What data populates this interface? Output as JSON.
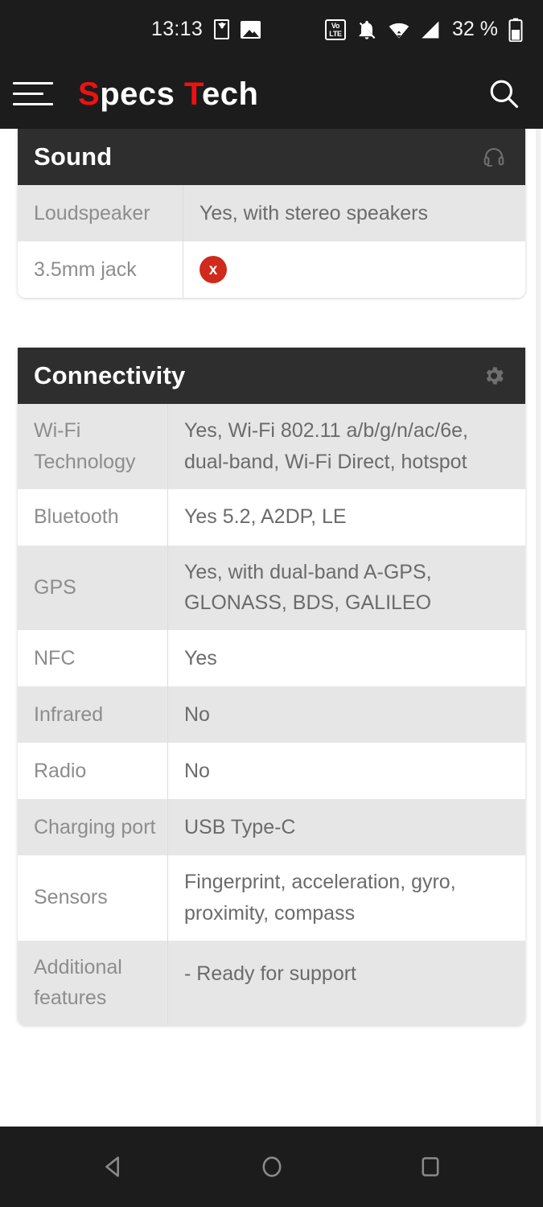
{
  "status_bar": {
    "time": "13:13",
    "battery_text": "32 %",
    "icons": [
      "download-icon",
      "photo-icon",
      "volte-icon",
      "notifications-muted-icon",
      "wifi-icon",
      "cellular-signal-icon",
      "battery-icon"
    ],
    "volte_top": "Vo",
    "volte_bottom": "LTE"
  },
  "app_bar": {
    "logo_part1": "S",
    "logo_part2": "pecs ",
    "logo_part3": "T",
    "logo_part4": "ech",
    "logo_full": "Specs Tech",
    "menu_icon": "hamburger-menu-icon",
    "search_icon": "search-icon",
    "accent_color": "#ee1111"
  },
  "sections": [
    {
      "title": "Sound",
      "icon": "headset-icon",
      "rows": [
        {
          "key": "Loudspeaker",
          "value": "Yes, with stereo speakers",
          "shaded": true,
          "badge": null
        },
        {
          "key": "3.5mm jack",
          "value": "",
          "shaded": false,
          "badge": "x"
        }
      ]
    },
    {
      "title": "Connectivity",
      "icon": "gear-icon",
      "rows": [
        {
          "key": "Wi-Fi Technology",
          "value": "Yes, Wi-Fi 802.11 a/b/g/n/ac/6e, dual-band, Wi-Fi Direct, hotspot",
          "shaded": true,
          "badge": null
        },
        {
          "key": "Bluetooth",
          "value": "Yes 5.2, A2DP, LE",
          "shaded": false,
          "badge": null
        },
        {
          "key": "GPS",
          "value": "Yes, with dual-band A-GPS, GLONASS, BDS, GALILEO",
          "shaded": true,
          "badge": null
        },
        {
          "key": "NFC",
          "value": "Yes",
          "shaded": false,
          "badge": null
        },
        {
          "key": "Infrared",
          "value": "No",
          "shaded": true,
          "badge": null
        },
        {
          "key": "Radio",
          "value": "No",
          "shaded": false,
          "badge": null
        },
        {
          "key": "Charging port",
          "value": "USB Type-C",
          "shaded": true,
          "badge": null
        },
        {
          "key": "Sensors",
          "value": "Fingerprint, acceleration, gyro, proximity, compass",
          "shaded": false,
          "badge": null
        },
        {
          "key": "Additional features",
          "value": "- Ready for support",
          "shaded": true,
          "badge": null
        }
      ]
    }
  ],
  "nav_bar": {
    "back_label": "back-button",
    "home_label": "home-button",
    "recents_label": "recents-button"
  },
  "colors": {
    "status_bar_bg": "#1c1c1c",
    "card_header_bg": "#2e2e2e",
    "row_shaded_bg": "#e6e6e6",
    "badge_red": "#cf2a1b",
    "logo_red": "#ee1111"
  }
}
